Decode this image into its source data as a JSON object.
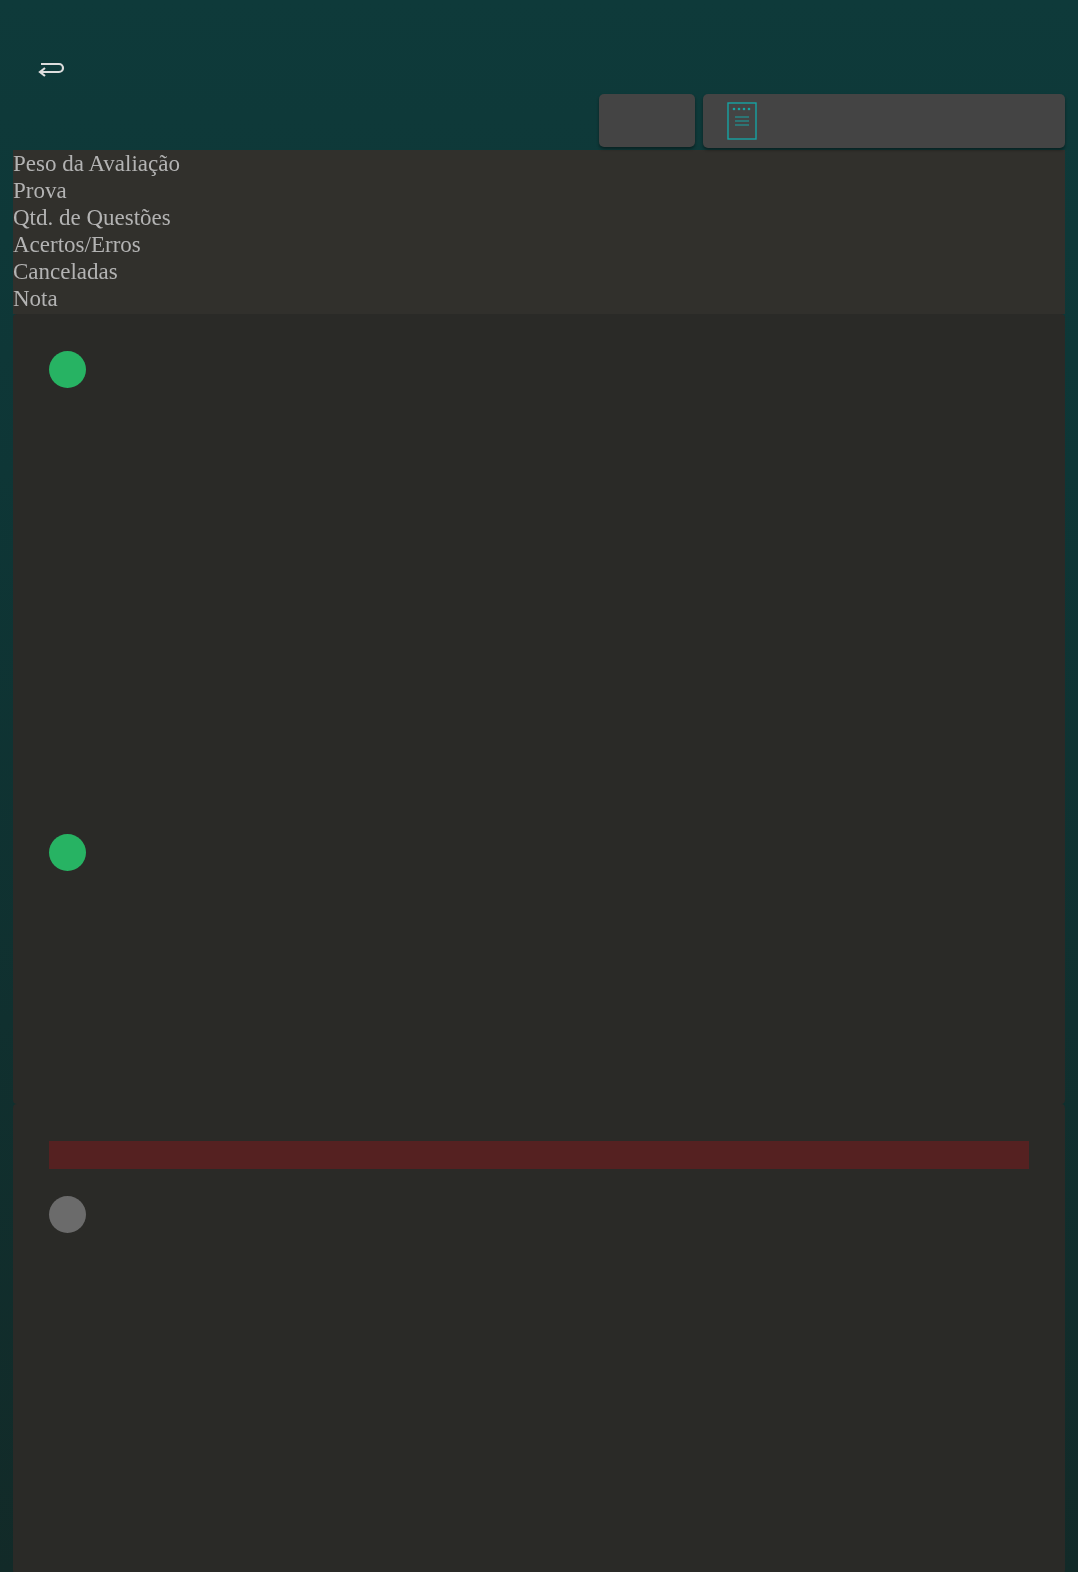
{
  "header_labels": [
    "Peso da Avaliação",
    "Prova",
    "Qtd. de Questões",
    "Acertos/Erros",
    "Canceladas",
    "Nota"
  ],
  "cards": [
    {
      "alert": false,
      "items": [
        {
          "color": "#27b363"
        },
        {
          "color": "#27b363"
        }
      ]
    },
    {
      "alert": true,
      "items": [
        {
          "color": "#6b6b6b"
        }
      ]
    }
  ]
}
